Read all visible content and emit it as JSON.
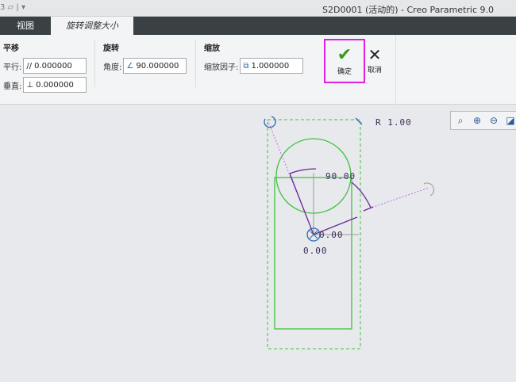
{
  "title": "S2D0001 (活动的) - Creo Parametric 9.0",
  "tabs": [
    {
      "label": "视图"
    },
    {
      "label": "旋转调整大小"
    }
  ],
  "translate": {
    "title": "平移",
    "parallel_label": "平行:",
    "parallel_value": "0.000000",
    "perp_label": "垂直:",
    "perp_value": "0.000000"
  },
  "rotate": {
    "title": "旋转",
    "angle_label": "角度:",
    "angle_value": "90.000000"
  },
  "scale": {
    "title": "缩放",
    "factor_label": "缩放因子:",
    "factor_value": "1.000000"
  },
  "buttons": {
    "ok": "确定",
    "cancel": "取消"
  },
  "sketch": {
    "radius": "R 1.00",
    "angle": "90.00",
    "dim_x": "0.00",
    "dim_y": "0.00"
  },
  "colors": {
    "sketch_green": "#3ec43e",
    "dim_purple": "#6a2a9a",
    "highlight": "#e020e0"
  }
}
